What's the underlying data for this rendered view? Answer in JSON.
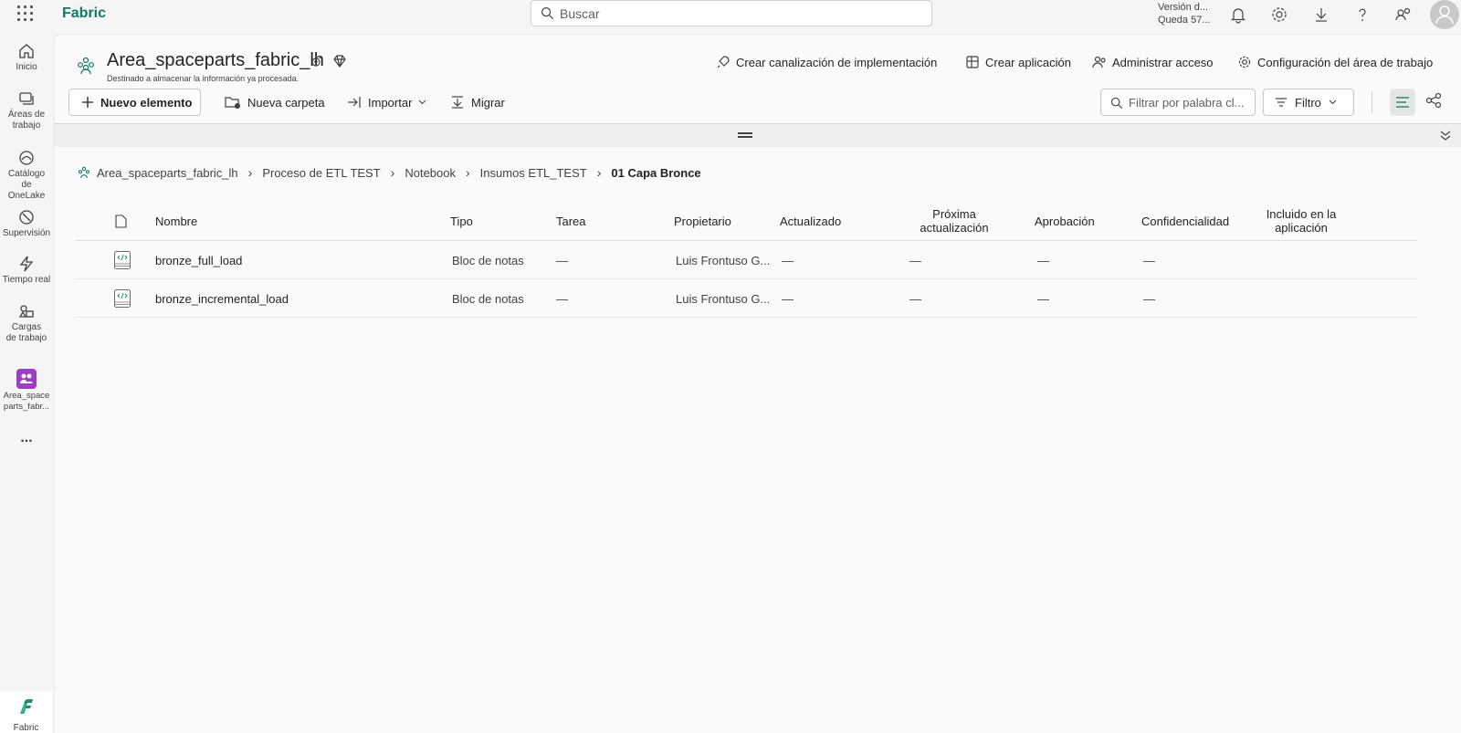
{
  "topbar": {
    "brand": "Fabric",
    "search_placeholder": "Buscar",
    "version_line1": "Versión d...",
    "version_line2": "Queda 57..."
  },
  "leftnav": {
    "items": [
      {
        "label": "Inicio",
        "icon": "home-icon"
      },
      {
        "label": "Áreas de trabajo",
        "icon": "workspaces-icon"
      },
      {
        "label": "Catálogo de OneLake",
        "icon": "onelake-catalog-icon"
      },
      {
        "label": "Supervisión",
        "icon": "monitor-icon"
      },
      {
        "label": "Tiempo real",
        "icon": "lightning-icon"
      },
      {
        "label": "Cargas de trabajo",
        "icon": "workloads-icon"
      },
      {
        "label": "Area_spaceparts_fabr...",
        "icon": "workspace-icon"
      }
    ],
    "more": "...",
    "bottom_label": "Fabric"
  },
  "workspace": {
    "title": "Area_spaceparts_fabric_lh",
    "description": "Destinado a almacenar la información ya procesada."
  },
  "header_actions": {
    "pipeline": "Crear canalización de implementación",
    "app": "Crear aplicación",
    "access": "Administrar acceso",
    "settings": "Configuración del área de trabajo"
  },
  "toolbar": {
    "new_item": "Nuevo elemento",
    "new_folder": "Nueva carpeta",
    "import": "Importar",
    "migrate": "Migrar",
    "filter_placeholder": "Filtrar por palabra cl...",
    "filter": "Filtro"
  },
  "breadcrumb": [
    "Area_spaceparts_fabric_lh",
    "Proceso de ETL TEST",
    "Notebook",
    "Insumos ETL_TEST",
    "01 Capa Bronce"
  ],
  "table": {
    "columns": {
      "name": "Nombre",
      "type": "Tipo",
      "task": "Tarea",
      "owner": "Propietario",
      "updated": "Actualizado",
      "next_update": "Próxima actualización",
      "approval": "Aprobación",
      "sensitivity": "Confidencialidad",
      "included": "Incluido en la aplicación"
    },
    "rows": [
      {
        "name": "bronze_full_load",
        "type": "Bloc de notas",
        "task": "—",
        "owner": "Luis Frontuso G...",
        "updated": "—",
        "next_update": "—",
        "approval": "—",
        "sensitivity": "—"
      },
      {
        "name": "bronze_incremental_load",
        "type": "Bloc de notas",
        "task": "—",
        "owner": "Luis Frontuso G...",
        "updated": "—",
        "next_update": "—",
        "approval": "—",
        "sensitivity": "—"
      }
    ]
  },
  "colors": {
    "brand": "#117865",
    "workspace_icon": "#9b3fc0"
  }
}
